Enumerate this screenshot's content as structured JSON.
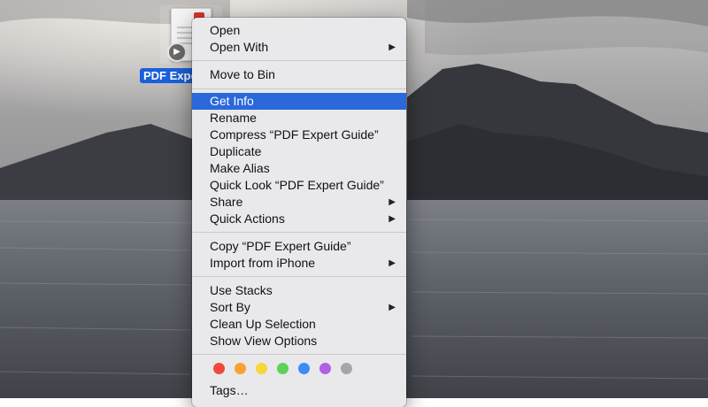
{
  "file": {
    "label": "PDF Expert Guide"
  },
  "menu": {
    "group1": [
      {
        "label": "Open"
      },
      {
        "label": "Open With",
        "submenu": true
      }
    ],
    "group2": [
      {
        "label": "Move to Bin"
      }
    ],
    "group3": [
      {
        "label": "Get Info",
        "highlighted": true
      },
      {
        "label": "Rename"
      },
      {
        "label": "Compress “PDF Expert Guide”"
      },
      {
        "label": "Duplicate"
      },
      {
        "label": "Make Alias"
      },
      {
        "label": "Quick Look “PDF Expert Guide”"
      },
      {
        "label": "Share",
        "submenu": true
      },
      {
        "label": "Quick Actions",
        "submenu": true
      }
    ],
    "group4": [
      {
        "label": "Copy “PDF Expert Guide”"
      },
      {
        "label": "Import from iPhone",
        "submenu": true
      }
    ],
    "group5": [
      {
        "label": "Use Stacks"
      },
      {
        "label": "Sort By",
        "submenu": true
      },
      {
        "label": "Clean Up Selection"
      },
      {
        "label": "Show View Options"
      }
    ],
    "submenu_glyph": "▶",
    "tag_colors": [
      {
        "name": "red",
        "color": "#f0483e"
      },
      {
        "name": "orange",
        "color": "#f7a233"
      },
      {
        "name": "yellow",
        "color": "#f6d63a"
      },
      {
        "name": "green",
        "color": "#5bd15a"
      },
      {
        "name": "blue",
        "color": "#3c8cf6"
      },
      {
        "name": "purple",
        "color": "#b15fe3"
      },
      {
        "name": "gray",
        "color": "#a6a6a8"
      }
    ],
    "tags_label": "Tags…"
  },
  "colors": {
    "highlight": "#2a68db",
    "menu_bg": "#e9e9ec"
  }
}
